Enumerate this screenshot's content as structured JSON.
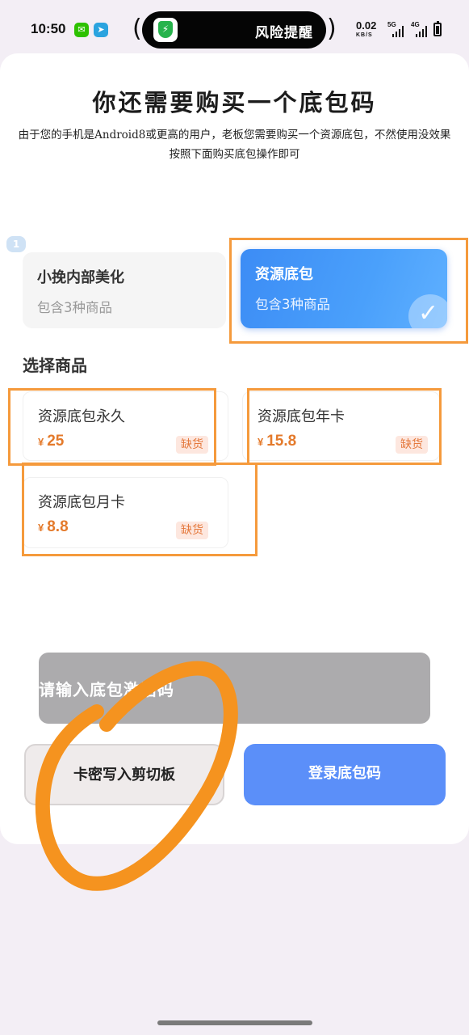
{
  "status_bar": {
    "time": "10:50",
    "wechat_icon": "wechat-icon",
    "telegram_icon": "telegram-icon",
    "alert_text": "风险提醒",
    "net_speed": "0.02",
    "net_unit": "KB/S",
    "signal_1": "5G",
    "signal_2": "4G"
  },
  "dialog": {
    "title": "你还需要购买一个底包码",
    "description": "由于您的手机是Android8或更高的用户，老板您需要购买一个资源底包，不然使用没效果 按照下面购买底包操作即可"
  },
  "packages": [
    {
      "name": "小挽内部美化",
      "sub": "包含3种商品",
      "selected": false
    },
    {
      "name": "资源底包",
      "sub": "包含3种商品",
      "selected": true
    }
  ],
  "badge_number": "1",
  "section_title": "选择商品",
  "products": [
    {
      "name": "资源底包永久",
      "currency": "¥",
      "price": "25",
      "status": "缺货"
    },
    {
      "name": "资源底包年卡",
      "currency": "¥",
      "price": "15.8",
      "status": "缺货"
    },
    {
      "name": "资源底包月卡",
      "currency": "¥",
      "price": "8.8",
      "status": "缺货"
    }
  ],
  "input": {
    "placeholder": "请输入底包激活码"
  },
  "buttons": {
    "copy_label": "卡密写入剪切板",
    "login_label": "登录底包码"
  },
  "colors": {
    "accent_blue": "#5b8ff9",
    "price_orange": "#e47a2b",
    "highlight_orange": "#f59a3c"
  }
}
